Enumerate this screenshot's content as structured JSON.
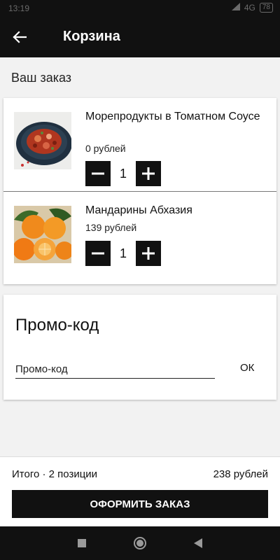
{
  "status_bar": {
    "time": "13:19",
    "network": "4G",
    "battery": "78"
  },
  "header": {
    "title": "Корзина"
  },
  "section_title": "Ваш заказ",
  "cart": {
    "items": [
      {
        "name": "Морепродукты в Томатном Соусе",
        "price": "0 рублей",
        "quantity": "1",
        "image": "seafood-tomato-sauce-photo"
      },
      {
        "name": "Мандарины Абхазия",
        "price": "139 рублей",
        "quantity": "1",
        "image": "tangerines-photo"
      }
    ]
  },
  "promo": {
    "title": "Промо-код",
    "placeholder": "Промо-код",
    "value": "",
    "ok_label": "ОК"
  },
  "summary": {
    "total_label": "Итого · 2 позиции",
    "total_value": "238 рублей",
    "checkout_label": "ОФОРМИТЬ ЗАКАЗ"
  },
  "colors": {
    "bar": "#111111",
    "background": "#f2f2f2",
    "card": "#ffffff",
    "text": "#111111"
  }
}
